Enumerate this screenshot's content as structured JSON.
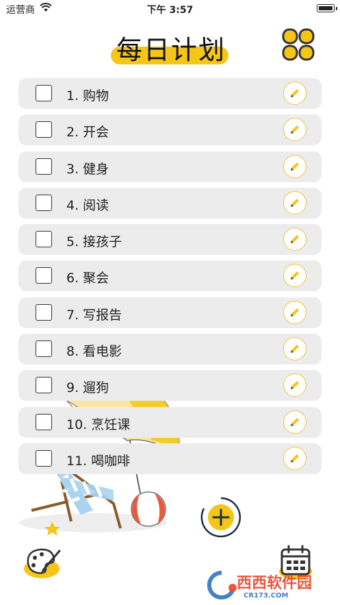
{
  "status": {
    "carrier": "运营商",
    "time": "下午 3:57"
  },
  "header": {
    "title": "每日计划",
    "accent": "#f5c518"
  },
  "tasks": [
    {
      "label": "1. 购物",
      "checked": false
    },
    {
      "label": "2. 开会",
      "checked": false
    },
    {
      "label": "3. 健身",
      "checked": false
    },
    {
      "label": "4. 阅读",
      "checked": false
    },
    {
      "label": "5. 接孩子",
      "checked": false
    },
    {
      "label": "6. 聚会",
      "checked": false
    },
    {
      "label": "7. 写报告",
      "checked": false
    },
    {
      "label": "8. 看电影",
      "checked": false
    },
    {
      "label": "9. 遛狗",
      "checked": false
    },
    {
      "label": "10. 烹饪课",
      "checked": false
    },
    {
      "label": "11. 喝咖啡",
      "checked": false
    }
  ],
  "icons": {
    "menu": "grid-menu-icon",
    "edit": "pencil-icon",
    "add": "plus-icon",
    "theme": "palette-icon",
    "calendar": "calendar-icon"
  },
  "watermark": {
    "brand": "西西软件园",
    "site": "CR173.COM"
  }
}
